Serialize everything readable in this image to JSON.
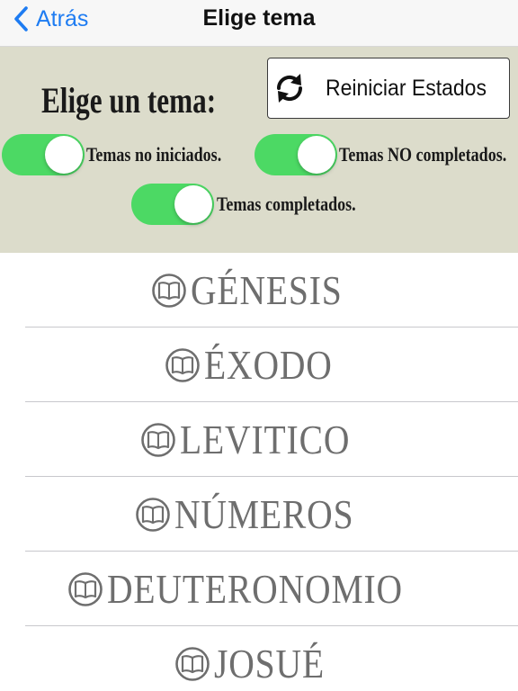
{
  "navbar": {
    "back_label": "Atrás",
    "title": "Elige tema",
    "accent_color": "#1e7cf2"
  },
  "filters": {
    "heading": "Elige un tema:",
    "reset_button": {
      "label": "Reiniciar Estados",
      "icon": "refresh-icon"
    },
    "toggles": [
      {
        "label": "Temas no iniciados.",
        "on": true
      },
      {
        "label": "Temas NO completados.",
        "on": true
      },
      {
        "label": "Temas completados.",
        "on": true
      }
    ],
    "panel_color": "#dcdccb",
    "toggle_color": "#4cd964"
  },
  "books": [
    {
      "name": "GÉNESIS",
      "icon": "book-icon"
    },
    {
      "name": "ÉXODO",
      "icon": "book-icon"
    },
    {
      "name": "LEVITICO",
      "icon": "book-icon"
    },
    {
      "name": "NÚMEROS",
      "icon": "book-icon"
    },
    {
      "name": "DEUTERONOMIO",
      "icon": "book-icon"
    },
    {
      "name": "JOSUÉ",
      "icon": "book-icon"
    }
  ]
}
